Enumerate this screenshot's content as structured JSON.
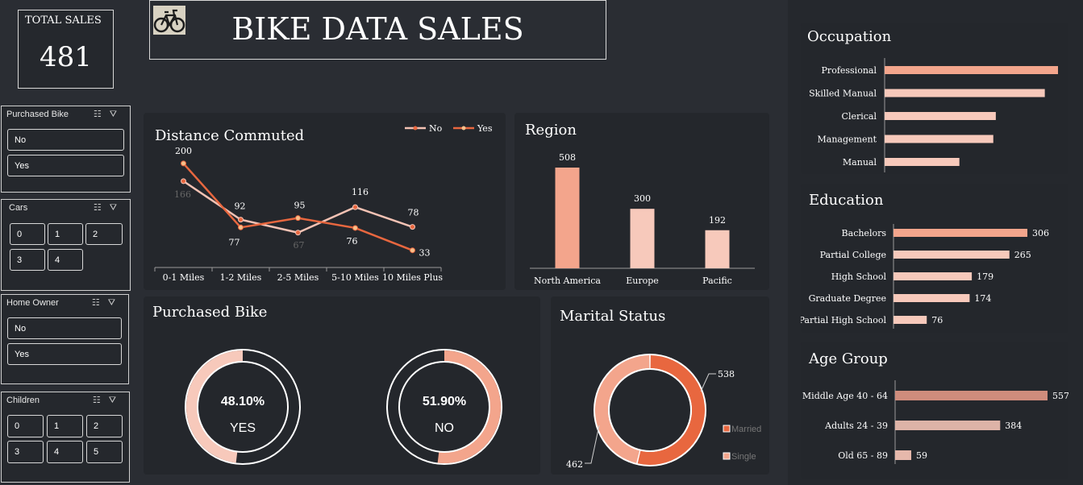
{
  "total_sales": {
    "label": "TOTAL SALES",
    "value": "481"
  },
  "header": {
    "title": "BIKE DATA SALES",
    "logo_icon": "bicycle-icon"
  },
  "colors": {
    "accent": "#e8673f",
    "soft": "#f3a58c",
    "pale": "#f7c9bb",
    "bg": "#2a2d33",
    "panel": "#24272c"
  },
  "slicers": [
    {
      "title": "Purchased Bike",
      "items": [
        "No",
        "Yes"
      ]
    },
    {
      "title": "Cars",
      "items": [
        "0",
        "1",
        "2",
        "3",
        "4"
      ]
    },
    {
      "title": "Home Owner",
      "items": [
        "No",
        "Yes"
      ]
    },
    {
      "title": "Children",
      "items": [
        "0",
        "1",
        "2",
        "3",
        "4",
        "5"
      ]
    }
  ],
  "panels": {
    "distance": "Distance Commuted",
    "region": "Region",
    "purchased": "Purchased Bike",
    "marital": "Marital Status",
    "occupation": "Occupation",
    "education": "Education",
    "age": "Age Group"
  },
  "chart_data": [
    {
      "id": "distance",
      "type": "line",
      "title": "Distance Commuted",
      "categories": [
        "0-1 Miles",
        "1-2 Miles",
        "2-5 Miles",
        "5-10 Miles",
        "10 Miles Plus"
      ],
      "series": [
        {
          "name": "No",
          "values": [
            166,
            92,
            67,
            116,
            78
          ],
          "color": "#f3c2b4"
        },
        {
          "name": "Yes",
          "values": [
            200,
            77,
            95,
            76,
            33
          ],
          "color": "#e8673f"
        }
      ],
      "legend": "top-right"
    },
    {
      "id": "region",
      "type": "bar",
      "title": "Region",
      "categories": [
        "North America",
        "Europe",
        "Pacific"
      ],
      "values": [
        508,
        300,
        192
      ],
      "colors": [
        "#f3a58c",
        "#f7c9bb",
        "#f7c9bb"
      ]
    },
    {
      "id": "purchased",
      "type": "pie",
      "title": "Purchased Bike",
      "donuts": [
        {
          "percent": 48.1,
          "percent_label": "48.10%",
          "label": "YES",
          "color": "#f7c9bb"
        },
        {
          "percent": 51.9,
          "percent_label": "51.90%",
          "label": "NO",
          "color": "#f3a58c"
        }
      ]
    },
    {
      "id": "marital",
      "type": "pie",
      "title": "Marital Status",
      "slices": [
        {
          "name": "Married",
          "value": 538,
          "color": "#e8673f"
        },
        {
          "name": "Single",
          "value": 462,
          "color": "#f3a58c"
        }
      ],
      "legend": "right"
    },
    {
      "id": "occupation",
      "type": "bar",
      "orientation": "horizontal",
      "title": "Occupation",
      "categories": [
        "Professional",
        "Skilled Manual",
        "Clerical",
        "Management",
        "Manual"
      ],
      "values": [
        276,
        255,
        177,
        173,
        119
      ],
      "data_labels": false,
      "colors": [
        "#f3a58c",
        "#f7c9bb",
        "#f7c9bb",
        "#f7c9bb",
        "#f7c9bb"
      ]
    },
    {
      "id": "education",
      "type": "bar",
      "orientation": "horizontal",
      "title": "Education",
      "categories": [
        "Bachelors",
        "Partial College",
        "High School",
        "Graduate Degree",
        "Partial High School"
      ],
      "values": [
        306,
        265,
        179,
        174,
        76
      ],
      "colors": [
        "#f3a58c",
        "#f7c9bb",
        "#f7c9bb",
        "#f7c9bb",
        "#f7c9bb"
      ]
    },
    {
      "id": "age",
      "type": "bar",
      "orientation": "horizontal",
      "title": "Age Group",
      "categories": [
        "Middle Age 40 - 64",
        "Adults 24 - 39",
        "Old 65 - 89"
      ],
      "values": [
        557,
        384,
        59
      ],
      "colors": [
        "#cf8c7c",
        "#ddb3a7",
        "#e6b8ab"
      ]
    }
  ]
}
